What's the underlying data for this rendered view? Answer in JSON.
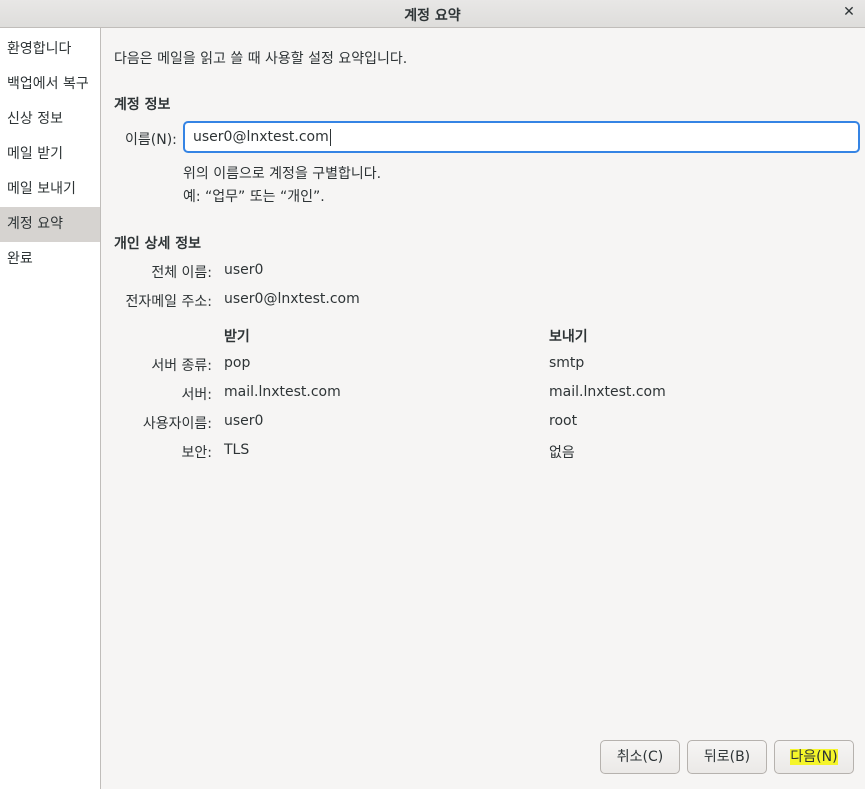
{
  "window": {
    "title": "계정 요약",
    "close_glyph": "✕"
  },
  "sidebar": {
    "items": [
      {
        "label": "환영합니다"
      },
      {
        "label": "백업에서 복구"
      },
      {
        "label": "신상 정보"
      },
      {
        "label": "메일 받기"
      },
      {
        "label": "메일 보내기"
      },
      {
        "label": "계정 요약",
        "active": true
      },
      {
        "label": "완료"
      }
    ]
  },
  "main": {
    "intro": "다음은 메일을 읽고 쓸 때 사용할 설정 요약입니다.",
    "account_section": {
      "heading": "계정 정보",
      "name_label": "이름(N):",
      "name_value": "user0@lnxtest.com",
      "hint_line1": "위의 이름으로 계정을 구별합니다.",
      "hint_line2": "예: “업무” 또는 “개인”."
    },
    "personal_section": {
      "heading": "개인 상세 정보",
      "full_name_label": "전체 이름:",
      "full_name_value": "user0",
      "email_label": "전자메일 주소:",
      "email_value": "user0@lnxtest.com"
    },
    "server_table": {
      "col_receive": "받기",
      "col_send": "보내기",
      "rows": [
        {
          "label": "서버 종류:",
          "receive": "pop",
          "send": "smtp"
        },
        {
          "label": "서버:",
          "receive": "mail.lnxtest.com",
          "send": "mail.lnxtest.com"
        },
        {
          "label": "사용자이름:",
          "receive": "user0",
          "send": "root"
        },
        {
          "label": "보안:",
          "receive": "TLS",
          "send": "없음"
        }
      ]
    }
  },
  "buttons": {
    "cancel": "취소(C)",
    "back": "뒤로(B)",
    "next": "다음(N)"
  },
  "colors": {
    "focus_border": "#3584e4",
    "highlight": "#f5f52a",
    "sidebar_active": "#d6d3d0"
  }
}
